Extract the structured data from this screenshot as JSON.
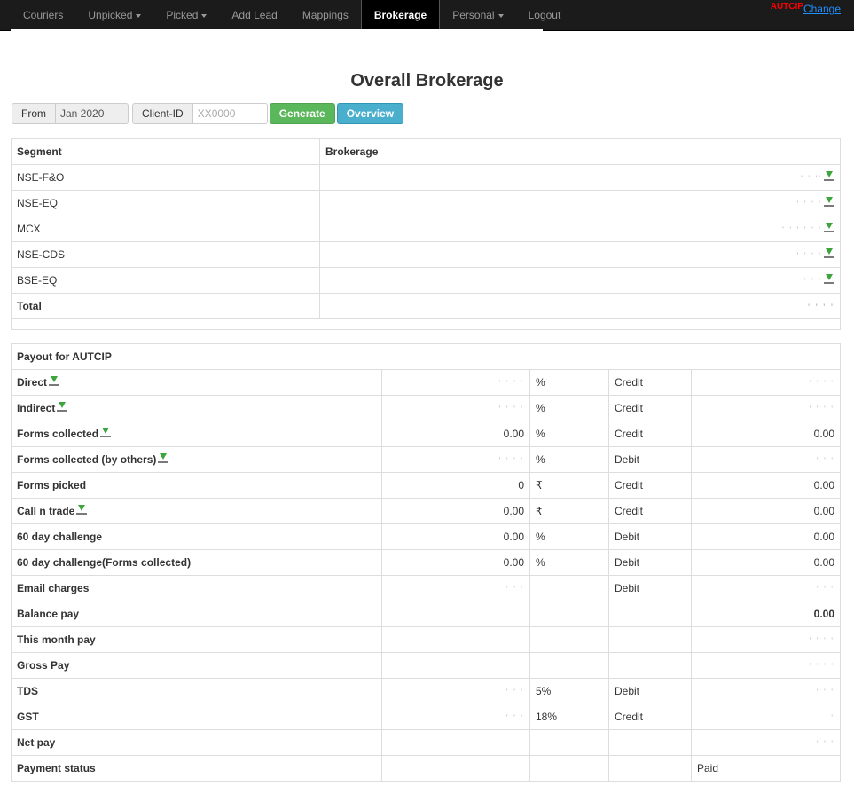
{
  "nav": {
    "items": [
      {
        "label": "Couriers",
        "dropdown": false,
        "active": false
      },
      {
        "label": "Unpicked",
        "dropdown": true,
        "active": false
      },
      {
        "label": "Picked",
        "dropdown": true,
        "active": false
      },
      {
        "label": "Add Lead",
        "dropdown": false,
        "active": false
      },
      {
        "label": "Mappings",
        "dropdown": false,
        "active": false
      },
      {
        "label": "Brokerage",
        "dropdown": false,
        "active": true
      },
      {
        "label": "Personal",
        "dropdown": true,
        "active": false
      },
      {
        "label": "Logout",
        "dropdown": false,
        "active": false
      }
    ],
    "user_label": "AUTCIP",
    "change_label": "Change"
  },
  "page": {
    "title": "Overall Brokerage"
  },
  "filters": {
    "from_label": "From",
    "from_value": "Jan 2020",
    "client_label": "Client-ID",
    "client_placeholder": "XX0000",
    "generate_label": "Generate",
    "overview_label": "Overview"
  },
  "segments": {
    "headers": [
      "Segment",
      "Brokerage"
    ],
    "rows": [
      {
        "segment": "NSE-F&O",
        "value": "' ' ''",
        "download": true
      },
      {
        "segment": "NSE-EQ",
        "value": "' ' ' '",
        "download": true
      },
      {
        "segment": "MCX",
        "value": "' ' ' ' ' '",
        "download": true
      },
      {
        "segment": "NSE-CDS",
        "value": "' ' ' '",
        "download": true
      },
      {
        "segment": "BSE-EQ",
        "value": "' ' '",
        "download": true
      }
    ],
    "total_label": "Total",
    "total_value": "' ' ' '"
  },
  "payout": {
    "title": "Payout for AUTCIP",
    "rows": [
      {
        "label": "Direct",
        "download": true,
        "value": "' ' ' '",
        "unit": "%",
        "type": "Credit",
        "amount": "' ' ' ' '",
        "bold_amount": false
      },
      {
        "label": "Indirect",
        "download": true,
        "value": "' ' ' '",
        "unit": "%",
        "type": "Credit",
        "amount": "' ' ' '",
        "bold_amount": false
      },
      {
        "label": "Forms collected",
        "download": true,
        "value": "0.00",
        "unit": "%",
        "type": "Credit",
        "amount": "0.00",
        "bold_amount": false
      },
      {
        "label": "Forms collected (by others)",
        "download": true,
        "value": "' ' ' '",
        "unit": "%",
        "type": "Debit",
        "amount": "' ' '",
        "bold_amount": false
      },
      {
        "label": "Forms picked",
        "download": false,
        "value": "0",
        "unit": "₹",
        "type": "Credit",
        "amount": "0.00",
        "bold_amount": false
      },
      {
        "label": "Call n trade",
        "download": true,
        "value": "0.00",
        "unit": "₹",
        "type": "Credit",
        "amount": "0.00",
        "bold_amount": false
      },
      {
        "label": "60 day challenge",
        "download": false,
        "value": "0.00",
        "unit": "%",
        "type": "Debit",
        "amount": "0.00",
        "bold_amount": false
      },
      {
        "label": "60 day challenge(Forms collected)",
        "download": false,
        "value": "0.00",
        "unit": "%",
        "type": "Debit",
        "amount": "0.00",
        "bold_amount": false
      },
      {
        "label": "Email charges",
        "download": false,
        "value": "' ' '",
        "unit": "",
        "type": "Debit",
        "amount": "' ' '",
        "bold_amount": false
      },
      {
        "label": "Balance pay",
        "download": false,
        "value": "",
        "unit": "",
        "type": "",
        "amount": "0.00",
        "bold_amount": true
      },
      {
        "label": "This month pay",
        "download": false,
        "value": "",
        "unit": "",
        "type": "",
        "amount": "' ' ' '",
        "bold_amount": false
      },
      {
        "label": "Gross Pay",
        "download": false,
        "value": "",
        "unit": "",
        "type": "",
        "amount": "' ' ' '",
        "bold_amount": false
      },
      {
        "label": "TDS",
        "download": false,
        "value": "' ' '",
        "unit": "5%",
        "type": "Debit",
        "amount": "' ' '",
        "bold_amount": false
      },
      {
        "label": "GST",
        "download": false,
        "value": "' ' '",
        "unit": "18%",
        "type": "Credit",
        "amount": "'",
        "bold_amount": false
      },
      {
        "label": "Net pay",
        "download": false,
        "value": "",
        "unit": "",
        "type": "",
        "amount": "' ' '",
        "bold_amount": false
      },
      {
        "label": "Payment status",
        "download": false,
        "value": "",
        "unit": "",
        "type": "",
        "amount": "Paid",
        "amount_left": true,
        "bold_amount": false
      }
    ]
  },
  "colors": {
    "navbar_bg": "#1b1b1b",
    "generate_green": "#5bb75b",
    "overview_blue": "#49afcd",
    "download_green": "#3ca53c",
    "change_link": "#1e90ff",
    "user_red": "#ff0000"
  }
}
